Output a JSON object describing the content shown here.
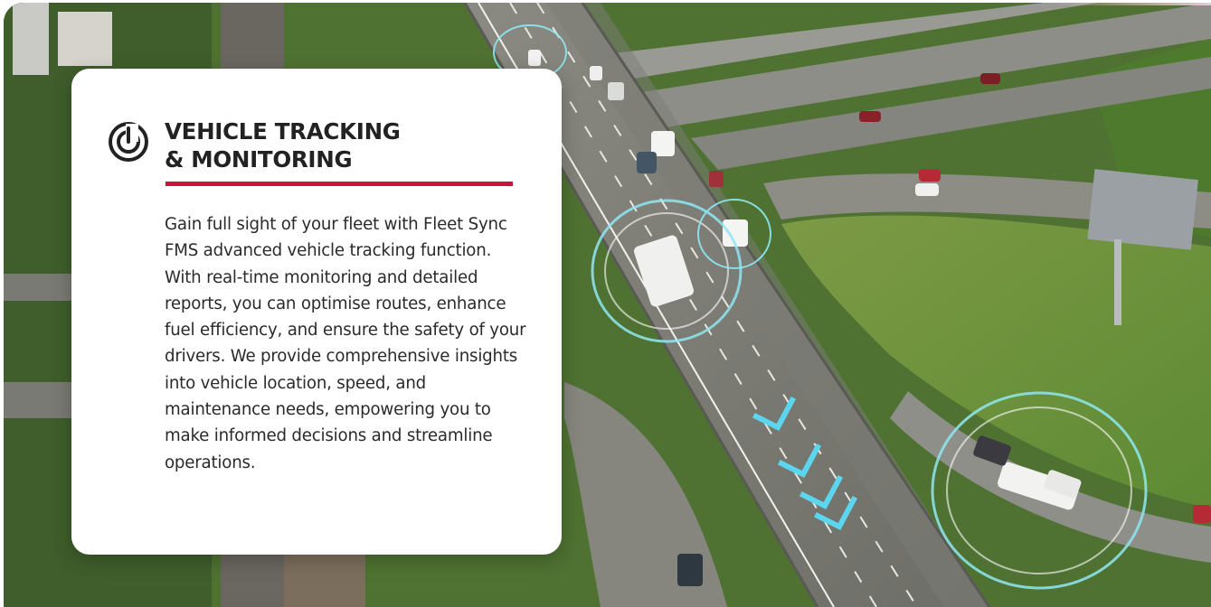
{
  "card": {
    "icon": "radar-tracking-icon",
    "title_line1": "VEHICLE TRACKING",
    "title_line2": "& MONITORING",
    "body": "Gain full sight of your fleet with Fleet Sync FMS advanced vehicle tracking function. With real-time monitoring and detailed reports, you can optimise routes, enhance fuel efficiency, and ensure the safety of your drivers. We provide comprehensive insights into vehicle location, speed, and maintenance needs, empowering you to make informed decisions and streamline operations."
  },
  "colors": {
    "accent": "#d0103a",
    "card_background": "#ffffff",
    "title_text": "#222222",
    "body_text": "#2a2a2a",
    "tracking_ring": "#8ee8f2",
    "direction_chevrons": "#5cd6ee"
  },
  "background_image": {
    "scene": "aerial view of highway interchange with tracked vehicles"
  }
}
